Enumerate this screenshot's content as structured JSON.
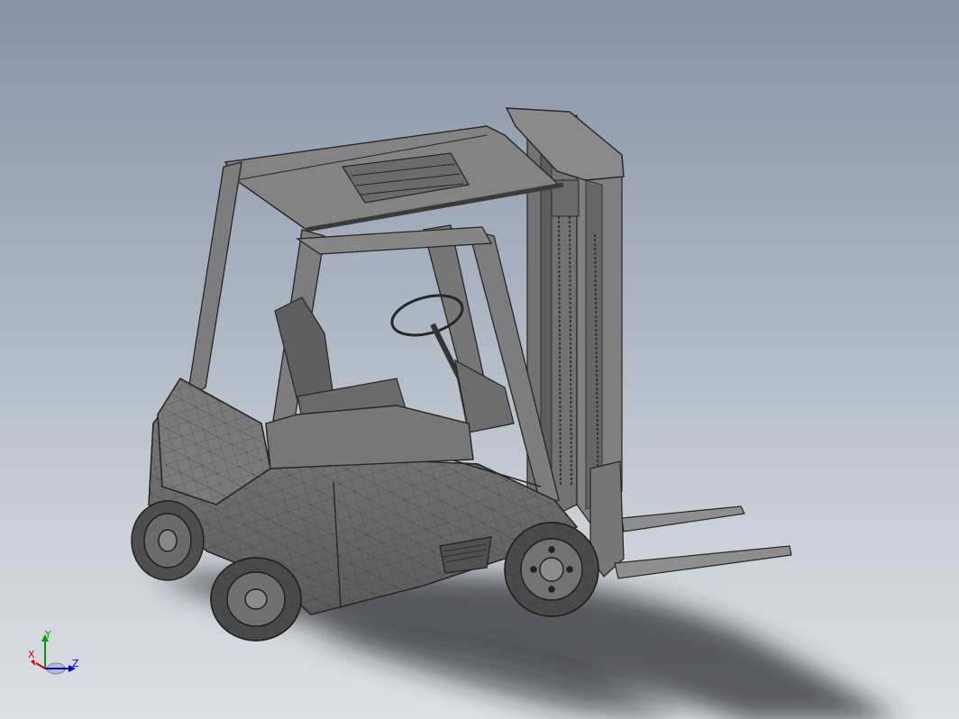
{
  "viewport": {
    "background_top": "#8693a6",
    "background_bottom": "#dcdfe4"
  },
  "model": {
    "icon": "forklift-model",
    "body_color": "#6e6e6e",
    "edge_color": "#262626"
  },
  "triad": {
    "x_label": "X",
    "y_label": "Y",
    "z_label": "Z",
    "x_color": "#d40000",
    "y_color": "#00a000",
    "z_color": "#0000e0"
  }
}
